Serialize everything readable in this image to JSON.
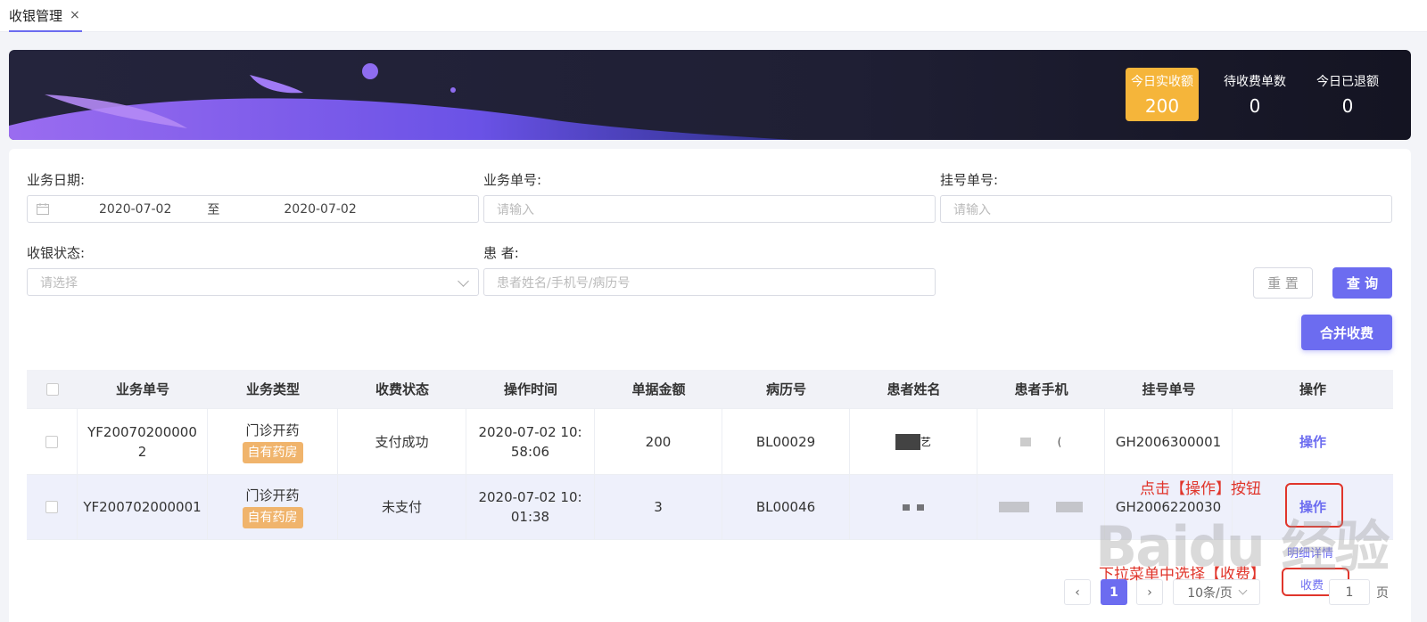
{
  "tab": {
    "label": "收银管理",
    "close": "×"
  },
  "stats": [
    {
      "label": "今日实收额",
      "value": "200"
    },
    {
      "label": "待收费单数",
      "value": "0"
    },
    {
      "label": "今日已退额",
      "value": "0"
    }
  ],
  "filters": {
    "date_label": "业务日期:",
    "date_start": "2020-07-02",
    "date_sep": "至",
    "date_end": "2020-07-02",
    "order_label": "业务单号:",
    "order_placeholder": "请输入",
    "reg_label": "挂号单号:",
    "reg_placeholder": "请输入",
    "status_label": "收银状态:",
    "status_placeholder": "请选择",
    "patient_label": "患 者:",
    "patient_placeholder": "患者姓名/手机号/病历号",
    "reset": "重 置",
    "search": "查 询",
    "merge": "合并收费"
  },
  "table": {
    "headers": [
      "业务单号",
      "业务类型",
      "收费状态",
      "操作时间",
      "单据金额",
      "病历号",
      "患者姓名",
      "患者手机",
      "挂号单号",
      "操作"
    ],
    "rows": [
      {
        "order_a": "YF20070200000",
        "order_b": "2",
        "type": "门诊开药",
        "tag": "自有药房",
        "status": "支付成功",
        "time_a": "2020-07-02 10:",
        "time_b": "58:06",
        "amount": "200",
        "record": "BL00029",
        "name_hint": "艺",
        "phone_hint": "(",
        "reg": "GH2006300001",
        "op": "操作"
      },
      {
        "order_a": "YF200702000001",
        "order_b": "",
        "type": "门诊开药",
        "tag": "自有药房",
        "status": "未支付",
        "time_a": "2020-07-02 10:",
        "time_b": "01:38",
        "amount": "3",
        "record": "BL00046",
        "name_hint": "",
        "phone_hint": "",
        "reg": "GH2006220030",
        "op": "操作"
      }
    ]
  },
  "annotations": {
    "click_op": "点击【操作】按钮",
    "dropdown_hint": "下拉菜单中选择【收费】",
    "menu_detail": "明细详情",
    "menu_charge": "收费"
  },
  "pagination": {
    "prev": "‹",
    "current": "1",
    "next": "›",
    "size": "10条/页",
    "goto": "1",
    "suffix": "页"
  },
  "watermark": "Baidu 经验",
  "colors": {
    "accent": "#6c6cf0",
    "highlight": "#f5b53a",
    "tag": "#f0b46c",
    "annotation": "#e0352b"
  }
}
